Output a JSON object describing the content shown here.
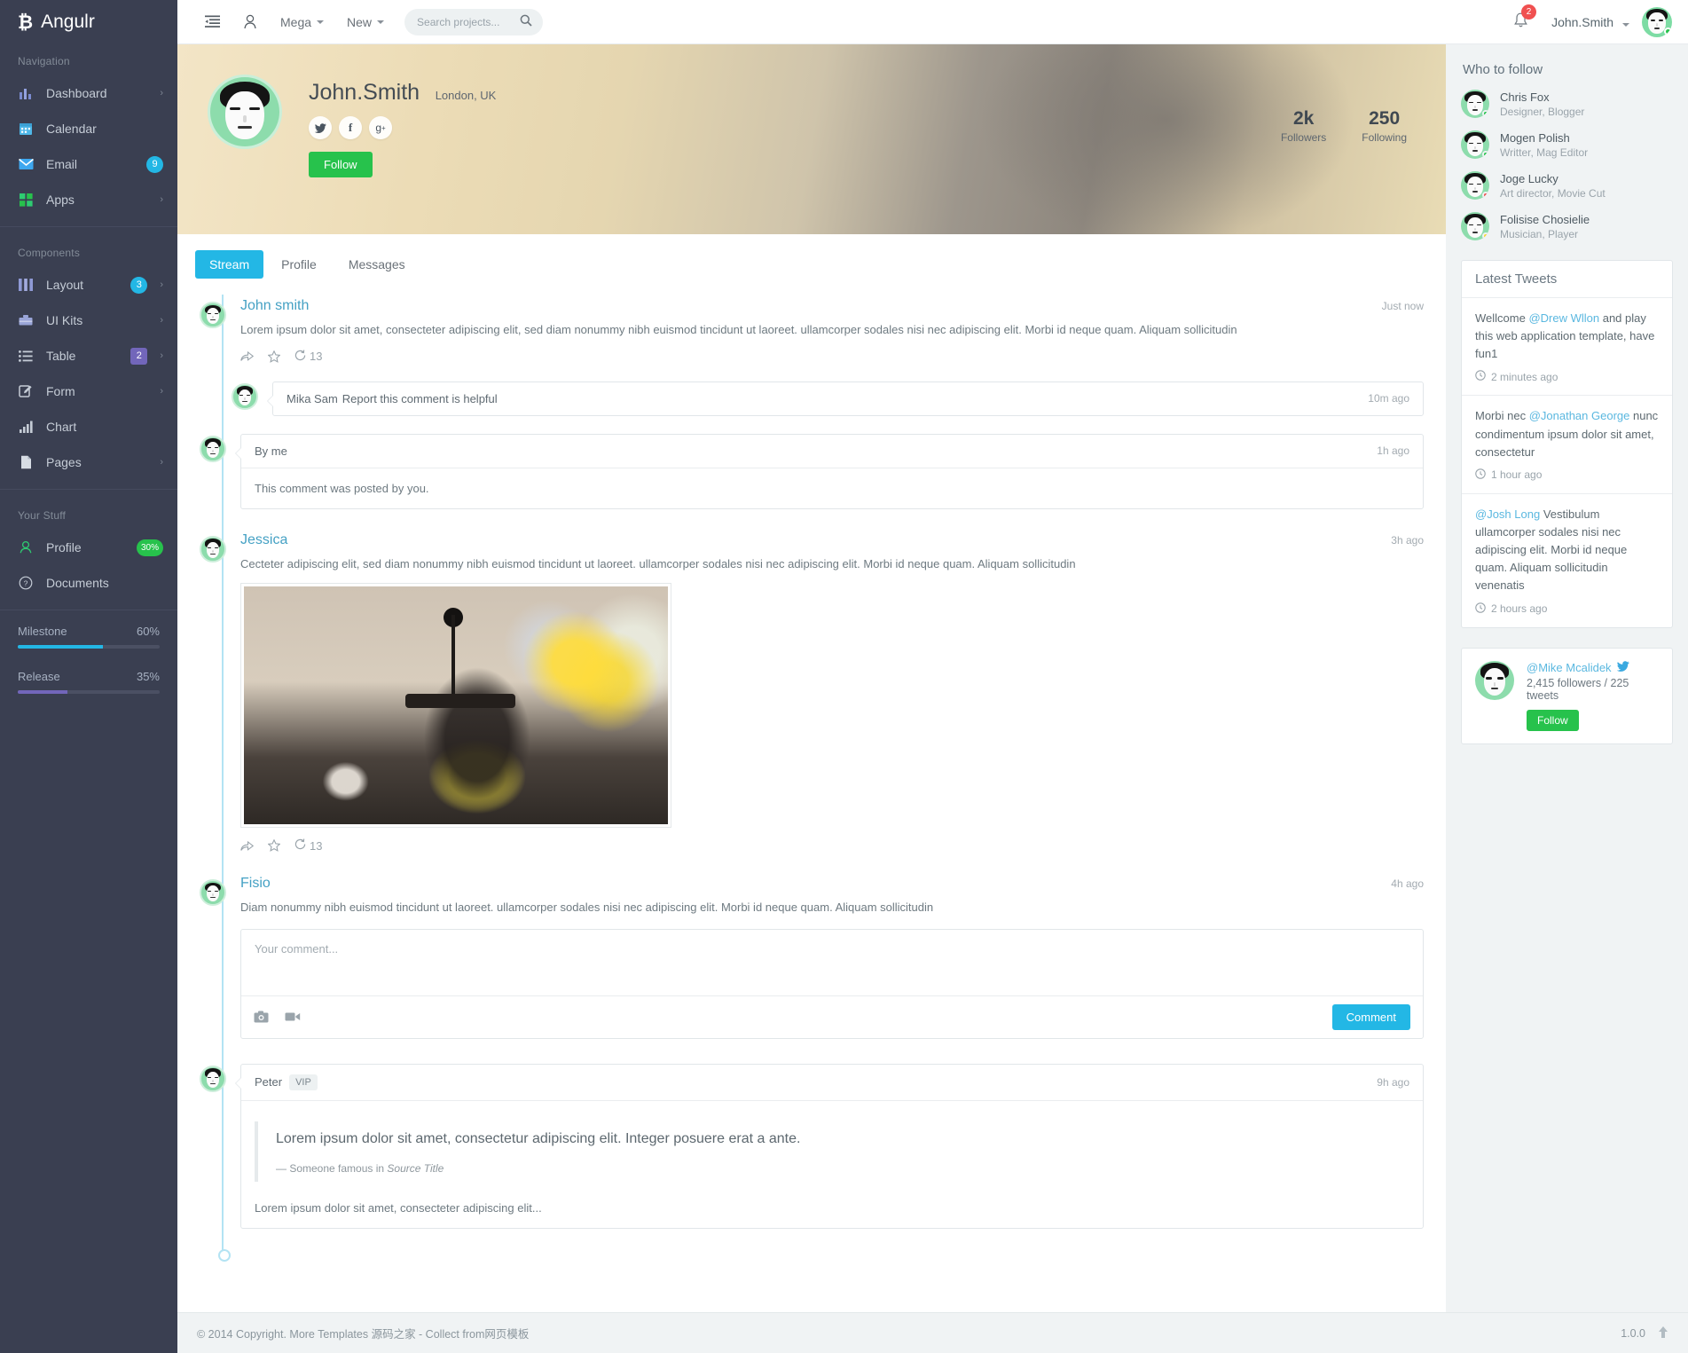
{
  "brand": {
    "name": "Angulr",
    "logo_icon": "bitcoin-icon"
  },
  "sidebar": {
    "sections": [
      {
        "heading": "Navigation",
        "items": [
          {
            "label": "Dashboard",
            "icon": "bar-chart-icon",
            "caret": true,
            "badge": null
          },
          {
            "label": "Calendar",
            "icon": "calendar-icon",
            "caret": false,
            "badge": null
          },
          {
            "label": "Email",
            "icon": "envelope-icon",
            "caret": false,
            "badge": "9",
            "badge_kind": "info"
          },
          {
            "label": "Apps",
            "icon": "grid-icon",
            "caret": true,
            "badge": null
          }
        ]
      },
      {
        "heading": "Components",
        "items": [
          {
            "label": "Layout",
            "icon": "columns-icon",
            "caret": true,
            "badge": "3",
            "badge_kind": "info"
          },
          {
            "label": "UI Kits",
            "icon": "briefcase-icon",
            "caret": true,
            "badge": null
          },
          {
            "label": "Table",
            "icon": "list-icon",
            "caret": true,
            "badge": "2",
            "badge_kind": "purple"
          },
          {
            "label": "Form",
            "icon": "edit-icon",
            "caret": true,
            "badge": null
          },
          {
            "label": "Chart",
            "icon": "signal-icon",
            "caret": false,
            "badge": null
          },
          {
            "label": "Pages",
            "icon": "file-icon",
            "caret": true,
            "badge": null
          }
        ]
      },
      {
        "heading": "Your Stuff",
        "items": [
          {
            "label": "Profile",
            "icon": "user-icon",
            "caret": false,
            "badge": "30%",
            "badge_kind": "green"
          },
          {
            "label": "Documents",
            "icon": "question-icon",
            "caret": false,
            "badge": null
          }
        ]
      }
    ],
    "progress": [
      {
        "label": "Milestone",
        "value": "60%",
        "pct": 60,
        "color": "#23b7e5"
      },
      {
        "label": "Release",
        "value": "35%",
        "pct": 35,
        "color": "#7266ba"
      }
    ]
  },
  "header": {
    "toggle_icon": "sidebar-toggle-icon",
    "user_icon": "user-outline-icon",
    "menus": [
      {
        "label": "Mega"
      },
      {
        "label": "New"
      }
    ],
    "search": {
      "placeholder": "Search projects...",
      "value": "",
      "icon": "search-icon"
    },
    "notifications": {
      "icon": "bell-icon",
      "count": "2"
    },
    "user": {
      "name": "John.Smith",
      "status": "online"
    }
  },
  "cover": {
    "profile_name": "John.Smith",
    "location": "London, UK",
    "socials": [
      {
        "name": "twitter-icon",
        "glyph": "🐦"
      },
      {
        "name": "facebook-icon",
        "glyph": "f"
      },
      {
        "name": "google-plus-icon",
        "glyph": "g+"
      }
    ],
    "follow_label": "Follow",
    "stats": [
      {
        "num": "2k",
        "label": "Followers"
      },
      {
        "num": "250",
        "label": "Following"
      }
    ]
  },
  "tabs": [
    {
      "label": "Stream",
      "active": true
    },
    {
      "label": "Profile",
      "active": false
    },
    {
      "label": "Messages",
      "active": false
    }
  ],
  "stream": {
    "post1": {
      "author": "John smith",
      "time": "Just now",
      "text": "Lorem ipsum dolor sit amet, consecteter adipiscing elit, sed diam nonummy nibh euismod tincidunt ut laoreet. ullamcorper sodales nisi nec adipiscing elit. Morbi id neque quam. Aliquam sollicitudin",
      "actions": {
        "share": "share-icon",
        "star": "star-icon",
        "comment_icon": "comment-icon",
        "comment_count": "13"
      }
    },
    "comment1": {
      "author": "Mika Sam",
      "text": "Report this comment is helpful",
      "time": "10m ago"
    },
    "comment2": {
      "author": "By me",
      "time": "1h ago",
      "body": "This comment was posted by you."
    },
    "post2": {
      "author": "Jessica",
      "time": "3h ago",
      "text": "Cecteter adipiscing elit, sed diam nonummy nibh euismod tincidunt ut laoreet. ullamcorper sodales nisi nec adipiscing elit. Morbi id neque quam. Aliquam sollicitudin",
      "image_alt": "teapot-photo",
      "actions": {
        "share": "share-icon",
        "star": "star-icon",
        "comment_icon": "comment-icon",
        "comment_count": "13"
      }
    },
    "post3": {
      "author": "Fisio",
      "time": "4h ago",
      "text": "Diam nonummy nibh euismod tincidunt ut laoreet. ullamcorper sodales nisi nec adipiscing elit. Morbi id neque quam. Aliquam sollicitudin"
    },
    "composer": {
      "placeholder": "Your comment...",
      "value": "",
      "photo_icon": "camera-icon",
      "video_icon": "video-icon",
      "submit_label": "Comment"
    },
    "post4": {
      "author": "Peter",
      "badge": "VIP",
      "time": "9h ago",
      "quote": "Lorem ipsum dolor sit amet, consectetur adipiscing elit. Integer posuere erat a ante.",
      "quote_attr_prefix": "— Someone famous in ",
      "quote_source": "Source Title",
      "body": "Lorem ipsum dolor sit amet, consecteter adipiscing elit..."
    }
  },
  "right": {
    "who_to_follow_title": "Who to follow",
    "people": [
      {
        "name": "Chris Fox",
        "role": "Designer, Blogger",
        "status_color": "#27c24c"
      },
      {
        "name": "Mogen Polish",
        "role": "Writter, Mag Editor",
        "status_color": "#27c24c"
      },
      {
        "name": "Joge Lucky",
        "role": "Art director, Movie Cut",
        "status_color": "#f05050"
      },
      {
        "name": "Folisise Chosielie",
        "role": "Musician, Player",
        "status_color": "#fad733"
      }
    ],
    "tweets_title": "Latest Tweets",
    "tweets": [
      {
        "pre": "Wellcome ",
        "handle": "@Drew Wllon",
        "post": " and play this web application template, have fun1",
        "time": "2 minutes ago",
        "clock_icon": "clock-icon"
      },
      {
        "pre": "Morbi nec ",
        "handle": "@Jonathan George",
        "post": " nunc condimentum ipsum dolor sit amet, consectetur",
        "time": "1 hour ago",
        "clock_icon": "clock-icon"
      },
      {
        "pre": "",
        "handle": "@Josh Long",
        "post": " Vestibulum ullamcorper sodales nisi nec adipiscing elit. Morbi id neque quam. Aliquam sollicitudin venenatis",
        "time": "2 hours ago",
        "clock_icon": "clock-icon"
      }
    ],
    "twitter_card": {
      "handle": "@Mike Mcalidek",
      "bird_icon": "twitter-icon",
      "stats": "2,415 followers / 225 tweets",
      "follow_label": "Follow"
    }
  },
  "footer": {
    "copyright": "© 2014 Copyright. More Templates 源码之家 - Collect from ",
    "link": "网页模板",
    "version": "1.0.0",
    "top_icon": "arrow-up-icon"
  }
}
